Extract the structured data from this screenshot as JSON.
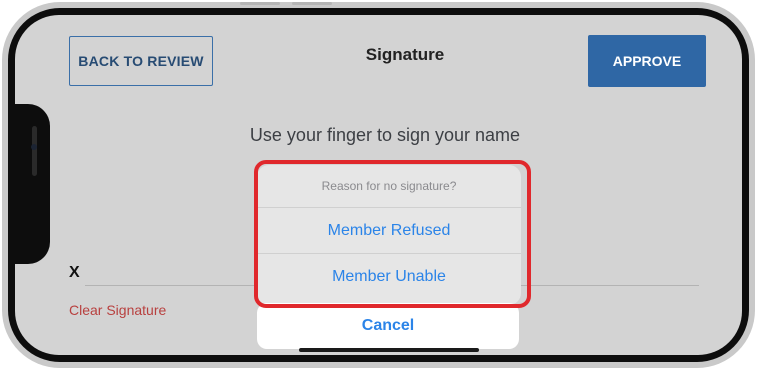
{
  "header": {
    "back_label": "BACK TO REVIEW",
    "title": "Signature",
    "approve_label": "APPROVE"
  },
  "signature": {
    "instruction": "Use your finger to sign your name",
    "x_mark": "X",
    "clear_label": "Clear Signature"
  },
  "action_sheet": {
    "title": "Reason for no signature?",
    "options": [
      "Member Refused",
      "Member Unable"
    ],
    "cancel_label": "Cancel"
  },
  "colors": {
    "primary": "#2f67a5",
    "action_blue": "#2b84e8",
    "destructive_red": "#b8403f",
    "highlight_red": "#e0282c"
  }
}
